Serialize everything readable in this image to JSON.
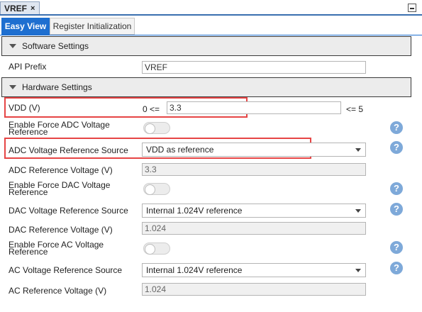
{
  "window": {
    "tab_title": "VREF",
    "close_icon": "×"
  },
  "view_tabs": [
    {
      "label": "Easy View",
      "active": true
    },
    {
      "label": "Register Initialization",
      "active": false
    }
  ],
  "software_settings": {
    "title": "Software Settings",
    "api_prefix": {
      "label": "API Prefix",
      "value": "VREF"
    }
  },
  "hardware_settings": {
    "title": "Hardware Settings",
    "vdd": {
      "label": "VDD (V)",
      "prefix": "0 <=",
      "value": "3.3",
      "suffix": "<= 5"
    },
    "force_adc": {
      "label_line1": "Enable Force ADC Voltage",
      "label_line2": "Reference",
      "on": false
    },
    "adc_source": {
      "label": "ADC Voltage Reference Source",
      "value": "VDD as reference"
    },
    "adc_voltage": {
      "label": "ADC Reference Voltage (V)",
      "value": "3.3"
    },
    "force_dac": {
      "label_line1": "Enable Force DAC Voltage",
      "label_line2": "Reference",
      "on": false
    },
    "dac_source": {
      "label": "DAC Voltage Reference Source",
      "value": "Internal 1.024V reference"
    },
    "dac_voltage": {
      "label": "DAC Reference Voltage (V)",
      "value": "1.024"
    },
    "force_ac": {
      "label_line1": "Enable Force AC Voltage",
      "label_line2": "Reference",
      "on": false
    },
    "ac_source": {
      "label": "AC Voltage Reference Source",
      "value": "Internal 1.024V reference"
    },
    "ac_voltage": {
      "label": "AC Reference Voltage (V)",
      "value": "1.024"
    }
  },
  "help_glyph": "?",
  "colors": {
    "accent": "#1e6fd0",
    "highlight": "#e64545",
    "help": "#7ea9d9"
  }
}
